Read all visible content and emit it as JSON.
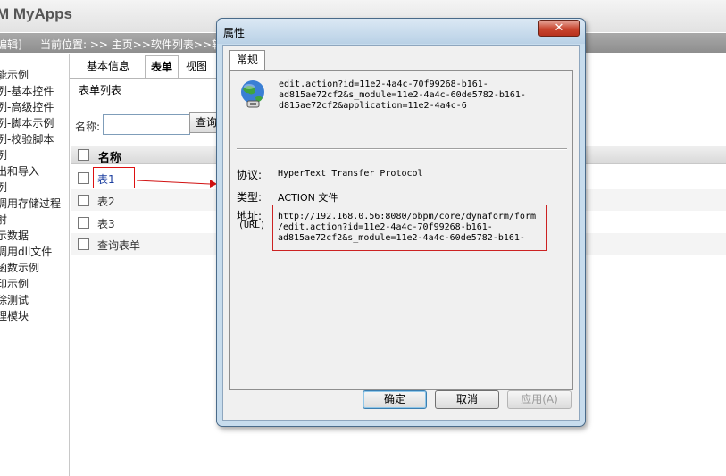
{
  "app": {
    "title": "M MyApps"
  },
  "location_bar": {
    "edit": "编辑]",
    "crumb": "当前位置: >> 主页>>软件列表>>软件"
  },
  "sidebar": {
    "items": [
      "能示例",
      "例-基本控件",
      "例-高级控件",
      "例-脚本示例",
      "例-校验脚本",
      "例",
      "出和导入",
      "例",
      "调用存储过程",
      "射",
      "示数据",
      "调用dll文件",
      "函数示例",
      "印示例",
      "除测试",
      "理模块"
    ]
  },
  "tabs": [
    {
      "label": "基本信息",
      "active": false
    },
    {
      "label": "表单",
      "active": true
    },
    {
      "label": "视图",
      "active": false
    }
  ],
  "form_list": {
    "subtitle": "表单列表",
    "name_label": "名称:",
    "name_value": "",
    "query_button": "查询",
    "column_header": "名称",
    "rows": [
      "表1",
      "表2",
      "表3",
      "查询表单"
    ]
  },
  "dialog": {
    "title": "属性",
    "close_symbol": "✕",
    "tab": "常规",
    "top_address": "edit.action?id=11e2-4a4c-70f99268-b161-\nad815ae72cf2&s_module=11e2-4a4c-60de5782-b161-\nd815ae72cf2&application=11e2-4a4c-6   ",
    "protocol_label": "协议:",
    "protocol_value": "HyperText Transfer Protocol",
    "type_label": "类型:",
    "type_value": "ACTION 文件",
    "address_label": "地址:",
    "address_sublabel": "(URL)",
    "url": "http://192.168.0.56:8080/obpm/core/dynaform/form\n/edit.action?id=11e2-4a4c-70f99268-b161-\nad815ae72cf2&s_module=11e2-4a4c-60de5782-b161-",
    "buttons": {
      "ok": "确定",
      "cancel": "取消",
      "apply": "应用(A)"
    }
  },
  "colors": {
    "highlight": "#d11111",
    "dialog_frame": "#c7dced",
    "link": "#1c3fa0"
  }
}
